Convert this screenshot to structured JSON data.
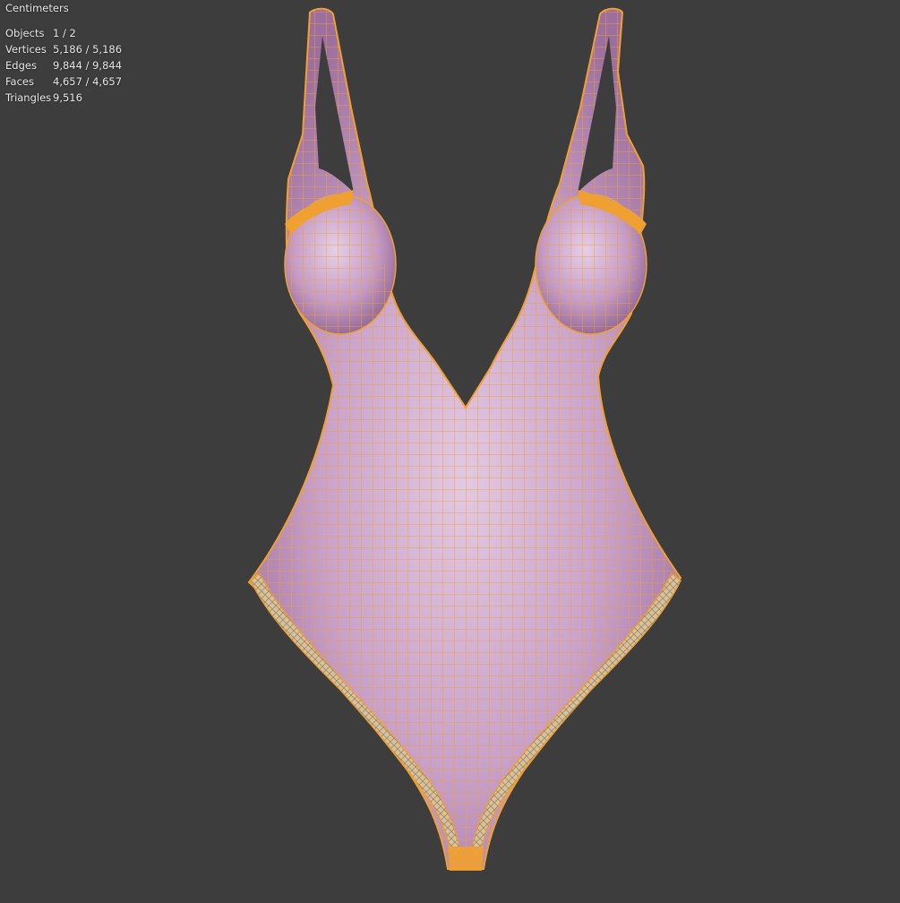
{
  "viewport": {
    "background": "#3d3d3d",
    "units_label": "Centimeters"
  },
  "statistics": [
    {
      "label": "Objects",
      "value": "1 / 2"
    },
    {
      "label": "Vertices",
      "value": "5,186 / 5,186"
    },
    {
      "label": "Edges",
      "value": "9,844 / 9,844"
    },
    {
      "label": "Faces",
      "value": "4,657 / 4,657"
    },
    {
      "label": "Triangles",
      "value": "9,516"
    }
  ],
  "model": {
    "surface_color": "#c9a2c9",
    "surface_highlight": "#e2c9e2",
    "surface_shadow": "#9d6f9e",
    "wire_color": "#f0a030",
    "lace_color": "#d8c29a"
  }
}
